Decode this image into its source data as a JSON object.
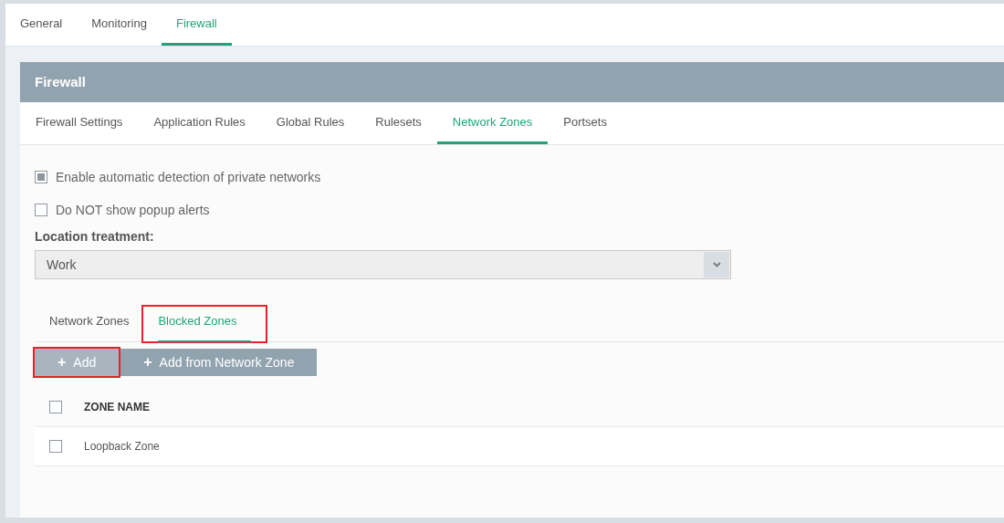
{
  "top_tabs": [
    {
      "label": "General",
      "selected": false
    },
    {
      "label": "Monitoring",
      "selected": false
    },
    {
      "label": "Firewall",
      "selected": true
    }
  ],
  "panel": {
    "title": "Firewall",
    "tabs": [
      {
        "label": "Firewall Settings",
        "selected": false
      },
      {
        "label": "Application Rules",
        "selected": false
      },
      {
        "label": "Global Rules",
        "selected": false
      },
      {
        "label": "Rulesets",
        "selected": false
      },
      {
        "label": "Network Zones",
        "selected": true
      },
      {
        "label": "Portsets",
        "selected": false
      }
    ],
    "options": [
      {
        "label": "Enable automatic detection of private networks",
        "checked": true
      },
      {
        "label": "Do NOT show popup alerts",
        "checked": false
      }
    ],
    "location": {
      "label": "Location treatment:",
      "value": "Work"
    },
    "zone_tabs": [
      {
        "label": "Network Zones",
        "selected": false,
        "highlighted": false
      },
      {
        "label": "Blocked Zones",
        "selected": true,
        "highlighted": true
      }
    ],
    "buttons": [
      {
        "icon": "+",
        "label": "Add",
        "hovered": true,
        "highlighted": true
      },
      {
        "icon": "+",
        "label": "Add from Network Zone",
        "hovered": false,
        "highlighted": false
      }
    ],
    "table": {
      "columns": [
        "ZONE NAME"
      ],
      "header_checked": false,
      "rows": [
        {
          "cells": [
            "Loopback Zone"
          ],
          "checked": false
        }
      ]
    }
  }
}
